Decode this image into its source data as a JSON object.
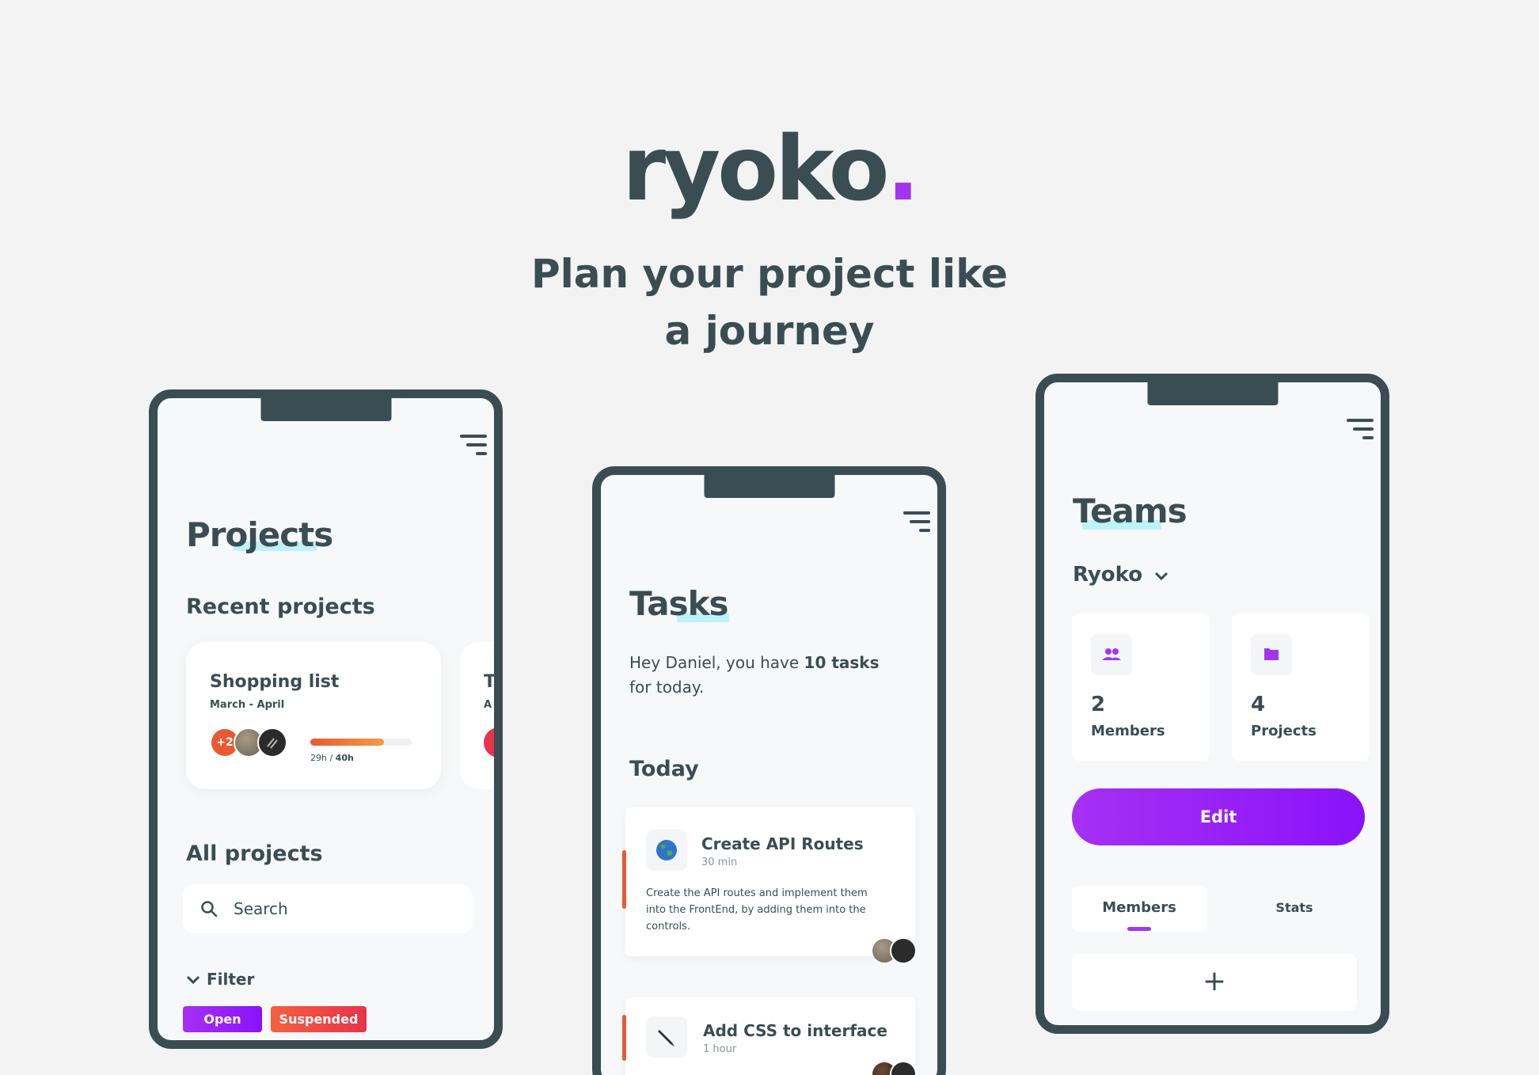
{
  "hero": {
    "logo": "ryoko",
    "logo_dot": ".",
    "tagline_line1": "Plan your project like",
    "tagline_line2": "a journey"
  },
  "colors": {
    "brand_dark": "#3a4d52",
    "accent_purple": "#a335f0",
    "accent_orange": "#e85a32",
    "highlight_cyan": "#bdf2f7"
  },
  "projects_screen": {
    "title": "Projects",
    "recent_heading": "Recent projects",
    "recent_card": {
      "name": "Shopping list",
      "dates": "March - April",
      "extra_members": "+2",
      "hours_spent": "29h",
      "hours_sep": " / ",
      "hours_total": "40h",
      "progress": 0.725
    },
    "recent_card_peek": {
      "name_initial": "T",
      "date_initial": "A"
    },
    "all_heading": "All projects",
    "search_placeholder": "Search",
    "filter_label": "Filter",
    "tags": [
      "Open",
      "Suspended"
    ]
  },
  "tasks_screen": {
    "title": "Tasks",
    "greeting_pre": "Hey Daniel, you have ",
    "greeting_bold": "10 tasks",
    "greeting_post": " for today.",
    "today_heading": "Today",
    "tasks": [
      {
        "icon": "globe-icon",
        "title": "Create API Routes",
        "duration": "30 min",
        "description": "Create the API routes and implement them into the FrontEnd, by adding them into the controls."
      },
      {
        "icon": "pen-icon",
        "title": "Add CSS to interface",
        "duration": "1 hour",
        "description": ""
      }
    ]
  },
  "teams_screen": {
    "title": "Teams",
    "team_selector": "Ryoko",
    "stats": [
      {
        "icon": "people-icon",
        "value": "2",
        "label": "Members"
      },
      {
        "icon": "folder-icon",
        "value": "4",
        "label": "Projects"
      }
    ],
    "edit_label": "Edit",
    "tabs": [
      "Members",
      "Stats"
    ],
    "active_tab": "Members",
    "add_label": "+"
  }
}
